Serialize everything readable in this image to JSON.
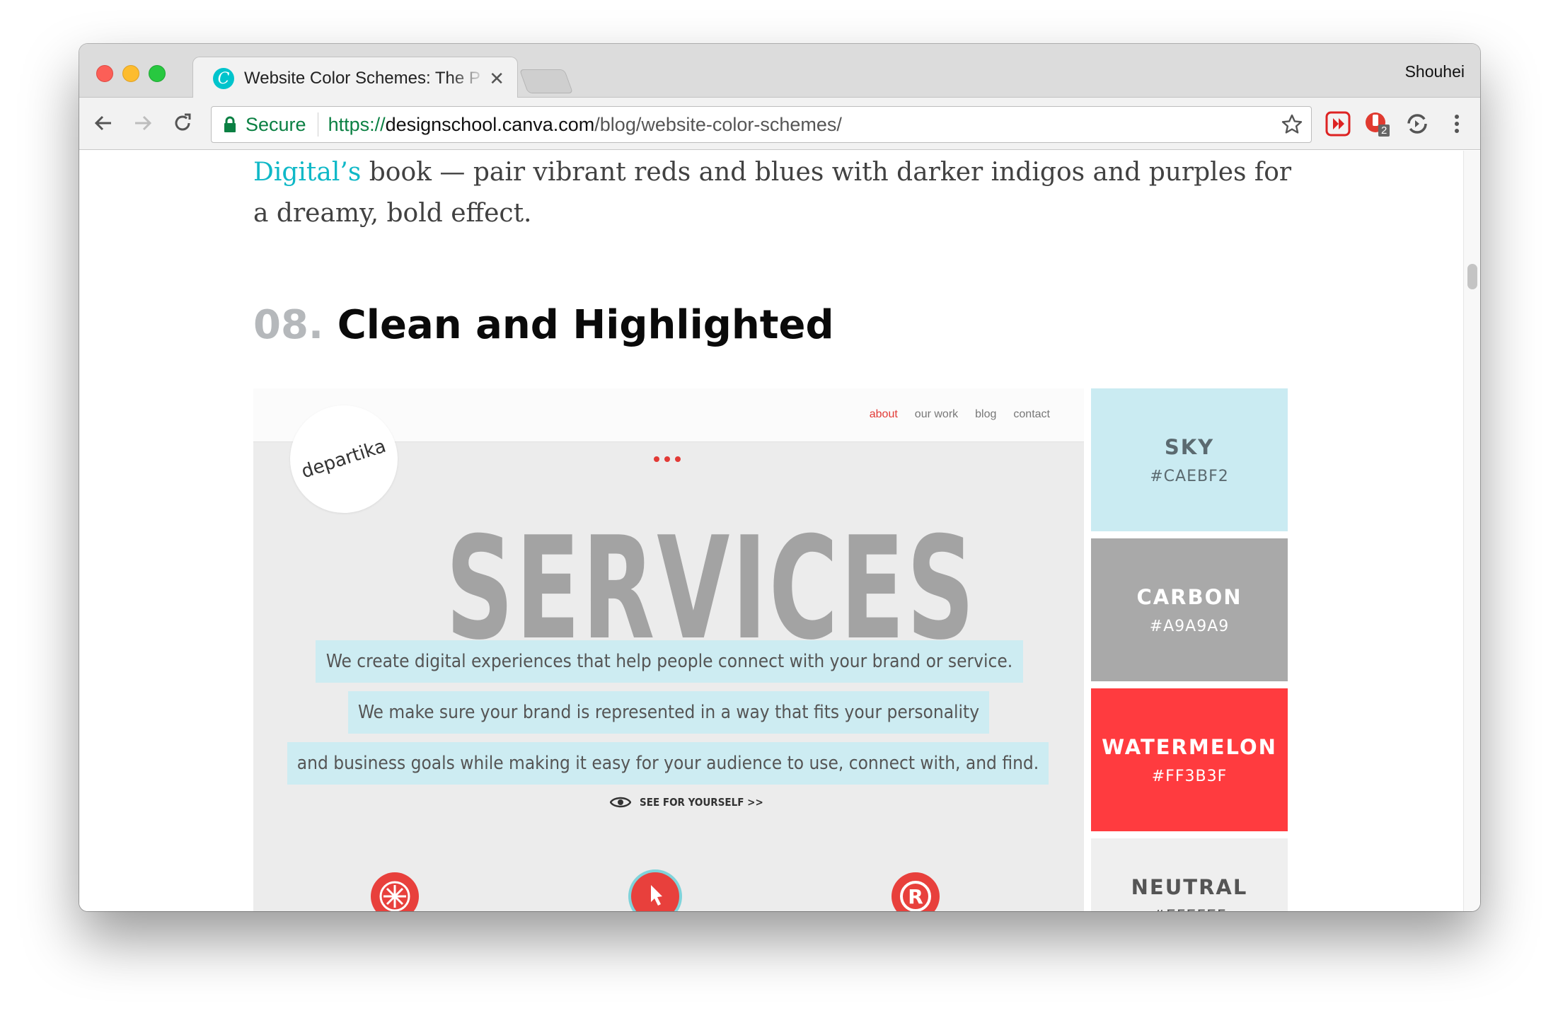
{
  "browser": {
    "tab_title": "Website Color Schemes: The P",
    "profile": "Shouhei",
    "secure_label": "Secure",
    "url_scheme": "https://",
    "url_host": "designschool.canva.com",
    "url_path": "/blog/website-color-schemes/",
    "extension_badge": "2",
    "favicon_letter": "C"
  },
  "article": {
    "paragraph_link": "Digital’s",
    "paragraph_text": " book — pair vibrant reds and blues with darker indigos and purples for a dreamy, bold effect.",
    "section_number": "08.",
    "section_title": "Clean and Highlighted"
  },
  "example_site": {
    "nav": [
      "about",
      "our work",
      "blog",
      "contact"
    ],
    "logo": "departika",
    "headline": "SERVICES",
    "lines": [
      "We create digital experiences that help people connect with your brand or service.",
      "We make sure your brand is represented in a way that fits your personality",
      "and business goals while making it easy for your audience to use, connect with, and find."
    ],
    "cta": "SEE FOR YOURSELF >>"
  },
  "swatches": [
    {
      "name": "SKY",
      "hex": "#CAEBF2",
      "color": "#CAEBF2",
      "text_color": "#5b6a70"
    },
    {
      "name": "CARBON",
      "hex": "#A9A9A9",
      "color": "#A9A9A9",
      "text_color": "#ffffff"
    },
    {
      "name": "WATERMELON",
      "hex": "#FF3B3F",
      "color": "#FF3B3F",
      "text_color": "#ffffff"
    },
    {
      "name": "NEUTRAL",
      "hex": "#EFEFEF",
      "color": "#EFEFEF",
      "text_color": "#555555"
    }
  ],
  "colors": {
    "accent": "#00c4cc",
    "link": "#0fb8c7",
    "secure": "#0b8043"
  }
}
